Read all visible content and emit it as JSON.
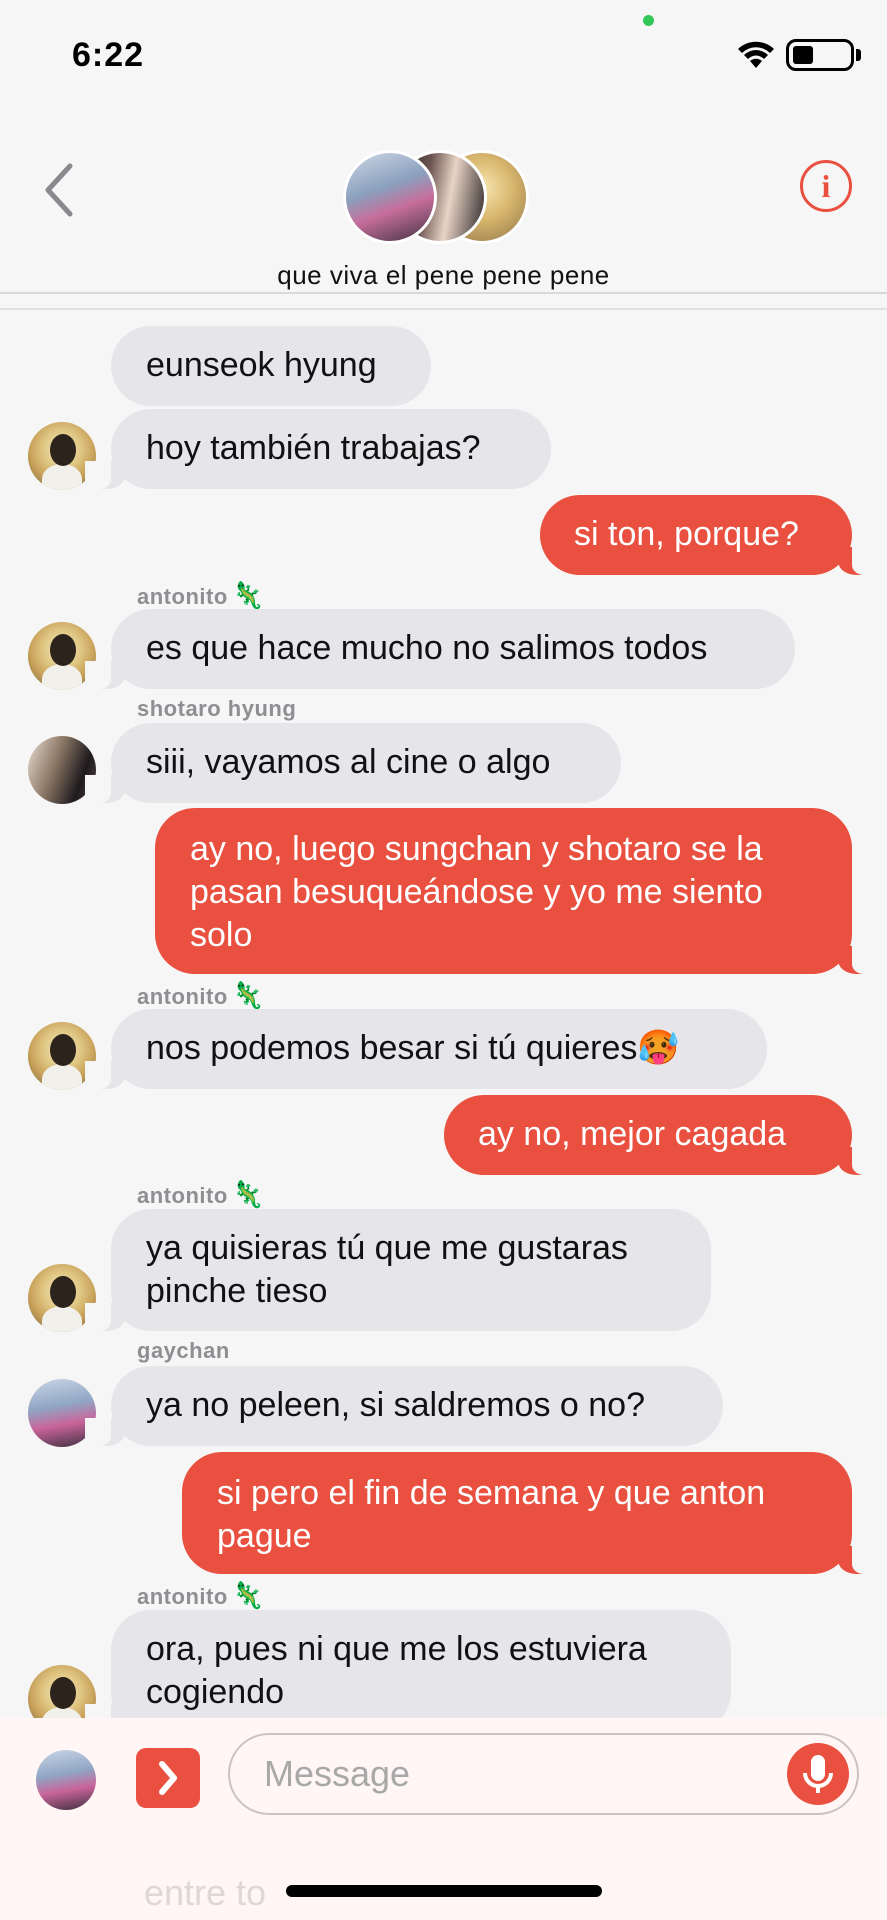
{
  "status": {
    "time": "6:22"
  },
  "header": {
    "group_name": "que viva el pene pene pene",
    "info_icon": "i"
  },
  "messages": [
    {
      "text": "eunseok hyung"
    },
    {
      "text": "hoy también trabajas?"
    },
    {
      "text": "si ton, porque?"
    },
    {
      "sender": "antonito",
      "sender_emoji": "🦎",
      "text": "es que hace mucho no salimos todos"
    },
    {
      "sender": "shotaro hyung",
      "text": "siii, vayamos al cine o algo"
    },
    {
      "text": "ay no, luego sungchan y shotaro se la pasan besuqueándose y yo me siento solo"
    },
    {
      "sender": "antonito",
      "sender_emoji": "🦎",
      "text": "nos podemos besar si tú quieres🥵"
    },
    {
      "text": "ay no, mejor cagada"
    },
    {
      "sender": "antonito",
      "sender_emoji": "🦎",
      "text": "ya quisieras tú que me gustaras pinche tieso"
    },
    {
      "sender": "gaychan",
      "text": "ya no peleen, si saldremos o no?"
    },
    {
      "text": "si pero el fin de semana y que anton pague"
    },
    {
      "sender": "antonito",
      "sender_emoji": "🦎",
      "text": "ora, pues ni que me los estuviera cogiendo"
    }
  ],
  "input": {
    "placeholder": "Message",
    "ghost_text": "entre to"
  },
  "colors": {
    "accent": "#e9503f",
    "incoming": "#e5e5ea",
    "background": "#f6f6f6"
  }
}
